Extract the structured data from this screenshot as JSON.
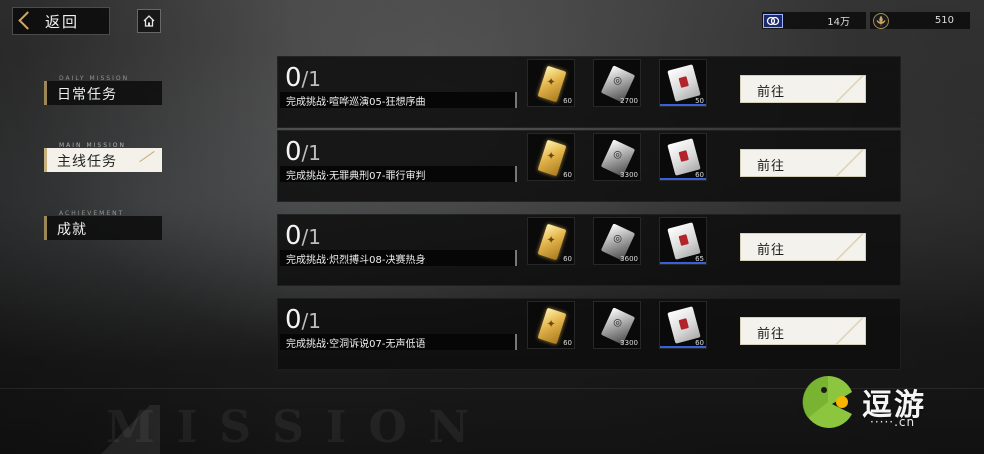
{
  "header": {
    "back_label": "返回",
    "resources": [
      {
        "icon": "coin-icon",
        "value": "14万"
      },
      {
        "icon": "fleur-de-lis-icon",
        "value": "510"
      }
    ]
  },
  "sidebar": {
    "tabs": [
      {
        "label": "日常任务",
        "en": "DAILY MISSION",
        "active": false
      },
      {
        "label": "主线任务",
        "en": "MAIN MISSION",
        "active": true
      },
      {
        "label": "成就",
        "en": "ACHIEVEMENT",
        "active": false
      }
    ]
  },
  "missions": [
    {
      "progress_done": "0",
      "progress_total": "/1",
      "desc": "完成挑战·喧哗巡演05-狂想序曲",
      "rewards": [
        {
          "icon": "gold-card-icon",
          "count": "60"
        },
        {
          "icon": "silver-card-icon",
          "count": "2700"
        },
        {
          "icon": "red-pack-icon",
          "count": "50"
        }
      ],
      "button": "前往"
    },
    {
      "progress_done": "0",
      "progress_total": "/1",
      "desc": "完成挑战·无罪典刑07-罪行审判",
      "rewards": [
        {
          "icon": "gold-card-icon",
          "count": "60"
        },
        {
          "icon": "silver-card-icon",
          "count": "3300"
        },
        {
          "icon": "red-pack-icon",
          "count": "60"
        }
      ],
      "button": "前往"
    },
    {
      "progress_done": "0",
      "progress_total": "/1",
      "desc": "完成挑战·炽烈搏斗08-决赛热身",
      "rewards": [
        {
          "icon": "gold-card-icon",
          "count": "60"
        },
        {
          "icon": "silver-card-icon",
          "count": "3600"
        },
        {
          "icon": "red-pack-icon",
          "count": "65"
        }
      ],
      "button": "前往"
    },
    {
      "progress_done": "0",
      "progress_total": "/1",
      "desc": "完成挑战·空洞诉说07-无声低语",
      "rewards": [
        {
          "icon": "gold-card-icon",
          "count": "60"
        },
        {
          "icon": "silver-card-icon",
          "count": "3300"
        },
        {
          "icon": "red-pack-icon",
          "count": "60"
        }
      ],
      "button": "前往"
    }
  ],
  "background": {
    "watermark": "MISSION"
  },
  "watermark_logo": {
    "text": "逗游",
    "url": "·····.cn"
  },
  "colors": {
    "accent_gold": "#c9a86a",
    "rarity_blue": "#3b5fd6",
    "tab_active_bg": "#f3f1ea"
  }
}
